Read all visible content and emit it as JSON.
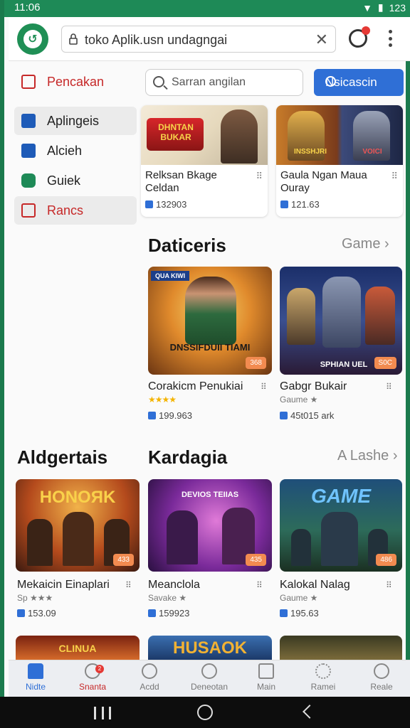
{
  "status": {
    "time": "11:06",
    "battery": "123"
  },
  "browser": {
    "url": "toko Aplik.usn undagngai"
  },
  "sidebar": {
    "items": [
      {
        "label": "Pencakan",
        "color": "#c62828"
      },
      {
        "label": "Aplingeis",
        "color": "#1e5bb8"
      },
      {
        "label": "Alcieh",
        "color": "#1e5bb8"
      },
      {
        "label": "Guiek",
        "color": "#1e8a57"
      },
      {
        "label": "Rancs",
        "color": "#c62828"
      }
    ]
  },
  "search": {
    "placeholder": "Sarran angilan",
    "button_label": "Nsicascin"
  },
  "featured": [
    {
      "banner": "DHNTAN BUKAR",
      "title": "Relksan Bkage Celdan",
      "count": "132903"
    },
    {
      "banner": "INSSHJRI",
      "banner2": "VOICI",
      "title": "Gaula Ngan Maua Ouray",
      "count": "121.63"
    }
  ],
  "section1": {
    "title": "Daticeris",
    "link": "Game",
    "tiles": [
      {
        "top_label": "QUA KIWI",
        "banner": "DNSSIFDUII TIAMI",
        "badge": "368",
        "name": "Corakicm Penukiai",
        "stars": "★★★★",
        "count": "199.963"
      },
      {
        "banner": "SPHIAN UEL",
        "badge": "S0C",
        "name": "Gabgr Bukair",
        "sub": "Gaume ★",
        "count": "45t015 ark"
      }
    ]
  },
  "section2": {
    "left_title": "Aldgertais",
    "title": "Kardagia",
    "link": "A Lashe",
    "tiles": [
      {
        "banner": "HONOЯK",
        "badge": "433",
        "name": "Mekaicin Einaplari",
        "sub": "Sp ★★★",
        "count": "153.09"
      },
      {
        "banner": "DEVIOS TEIIAS",
        "badge": "435",
        "name": "Meanclola",
        "sub": "Savake ★",
        "count": "159923"
      },
      {
        "banner": "GAME",
        "badge": "486",
        "name": "Kalokal Nalag",
        "sub": "Gaume ★",
        "count": "195.63"
      }
    ]
  },
  "bottom_row": [
    {
      "banner": "CLINUA"
    },
    {
      "banner": "HUSAOK"
    },
    {
      "banner": ""
    }
  ],
  "bottom_nav": [
    {
      "label": "Nidte"
    },
    {
      "label": "Snanta",
      "badge": "2"
    },
    {
      "label": "Acdd"
    },
    {
      "label": "Deneotan"
    },
    {
      "label": "Main"
    },
    {
      "label": "Ramei"
    },
    {
      "label": "Reale"
    }
  ]
}
